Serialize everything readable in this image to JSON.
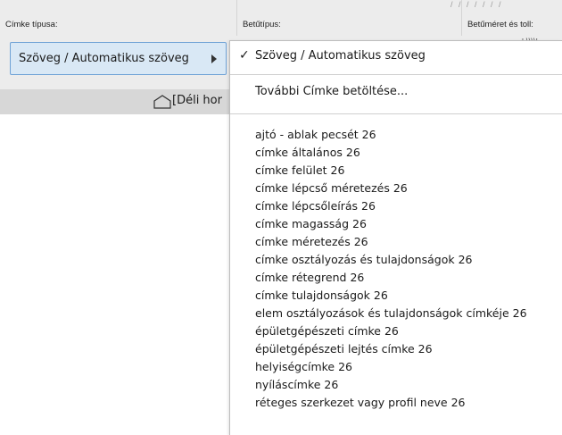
{
  "columns": {
    "label_type": "Címke típusa:",
    "font": "Betűtípus:",
    "size_and_pen": "Betűméret és toll:"
  },
  "decor": {
    "hatch_text": "/ / /   / /   / /",
    "size_value_mark": "' \\\\\\\\'"
  },
  "type_select": {
    "value": "Szöveg / Automatikus szöveg",
    "arrow_icon": "triangle-right-icon"
  },
  "strip": {
    "icon": "home-icon",
    "label": "[Déli hor"
  },
  "menu": {
    "selected": "Szöveg / Automatikus szöveg",
    "load_more": "További Címke betöltése...",
    "items": [
      "ajtó - ablak pecsét 26",
      "címke általános 26",
      "címke felület 26",
      "címke lépcső méretezés 26",
      "címke lépcsőleírás 26",
      "címke magasság 26",
      "címke méretezés 26",
      "címke osztályozás és tulajdonságok 26",
      "címke rétegrend 26",
      "címke tulajdonságok 26",
      "elem osztályozások és tulajdonságok címkéje 26",
      "épületgépészeti címke 26",
      "épületgépészeti lejtés címke 26",
      "helyiségcímke 26",
      "nyíláscímke 26",
      "réteges szerkezet vagy profil neve 26"
    ]
  },
  "colors": {
    "panel_bg": "#ececec",
    "select_bg": "#d9e8f5",
    "select_border": "#6fa2d6",
    "strip_bg": "#d7d7d7",
    "menu_bg": "#ffffff"
  }
}
